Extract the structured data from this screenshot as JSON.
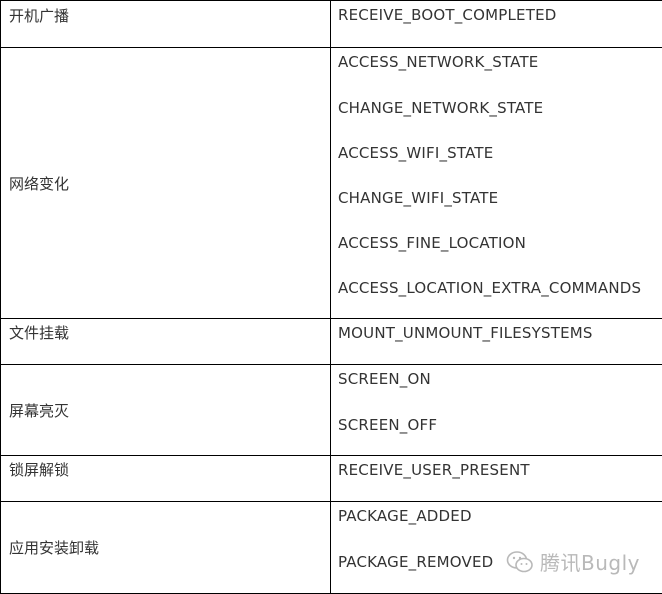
{
  "table": {
    "rows": [
      {
        "category": "开机广播",
        "permissions": [
          "RECEIVE_BOOT_COMPLETED"
        ]
      },
      {
        "category": "网络变化",
        "permissions": [
          "ACCESS_NETWORK_STATE",
          "CHANGE_NETWORK_STATE",
          "ACCESS_WIFI_STATE",
          "CHANGE_WIFI_STATE",
          "ACCESS_FINE_LOCATION",
          "ACCESS_LOCATION_EXTRA_COMMANDS"
        ]
      },
      {
        "category": "文件挂载",
        "permissions": [
          "MOUNT_UNMOUNT_FILESYSTEMS"
        ]
      },
      {
        "category": "屏幕亮灭",
        "permissions": [
          "SCREEN_ON",
          "SCREEN_OFF"
        ]
      },
      {
        "category": "锁屏解锁",
        "permissions": [
          "RECEIVE_USER_PRESENT"
        ]
      },
      {
        "category": "应用安装卸载",
        "permissions": [
          "PACKAGE_ADDED",
          "PACKAGE_REMOVED"
        ]
      }
    ]
  },
  "watermark": {
    "text": "腾讯Bugly",
    "icon": "wechat-icon"
  }
}
